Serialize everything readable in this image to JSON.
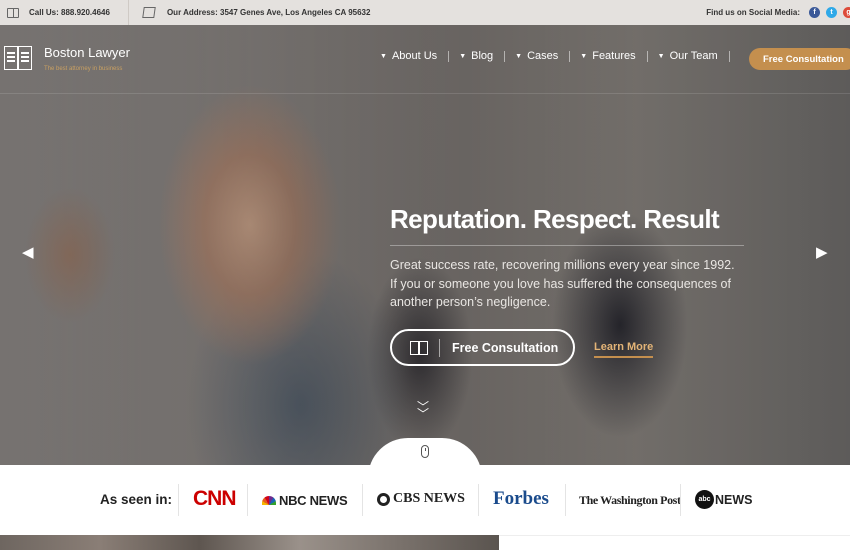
{
  "topbar": {
    "call": "Call Us: 888.920.4646",
    "address": "Our Address: 3547 Genes Ave, Los Angeles CA 95632",
    "social_label": "Find us on Social Media:",
    "social": [
      "f",
      "t",
      "g"
    ]
  },
  "brand": {
    "name": "Boston Lawyer",
    "tagline": "The best attorney in business"
  },
  "nav": {
    "items": [
      "About Us",
      "Blog",
      "Cases",
      "Features",
      "Our Team"
    ],
    "cta": "Free Consultation"
  },
  "hero": {
    "headline": "Reputation. Respect. Result",
    "subtext": "Great success rate, recovering millions every year since 1992. If you or someone you love has suffered the consequences of another person’s negligence.",
    "primary_button": "Free Consultation",
    "secondary_link": "Learn More"
  },
  "press": {
    "label": "As seen in:",
    "logos": [
      "CNN",
      "NBC NEWS",
      "CBS NEWS",
      "Forbes",
      "The Washington Post",
      "NEWS"
    ],
    "abc_mark": "abc"
  },
  "colors": {
    "accent": "#c48f4e",
    "topbar": "#e4e1de"
  }
}
